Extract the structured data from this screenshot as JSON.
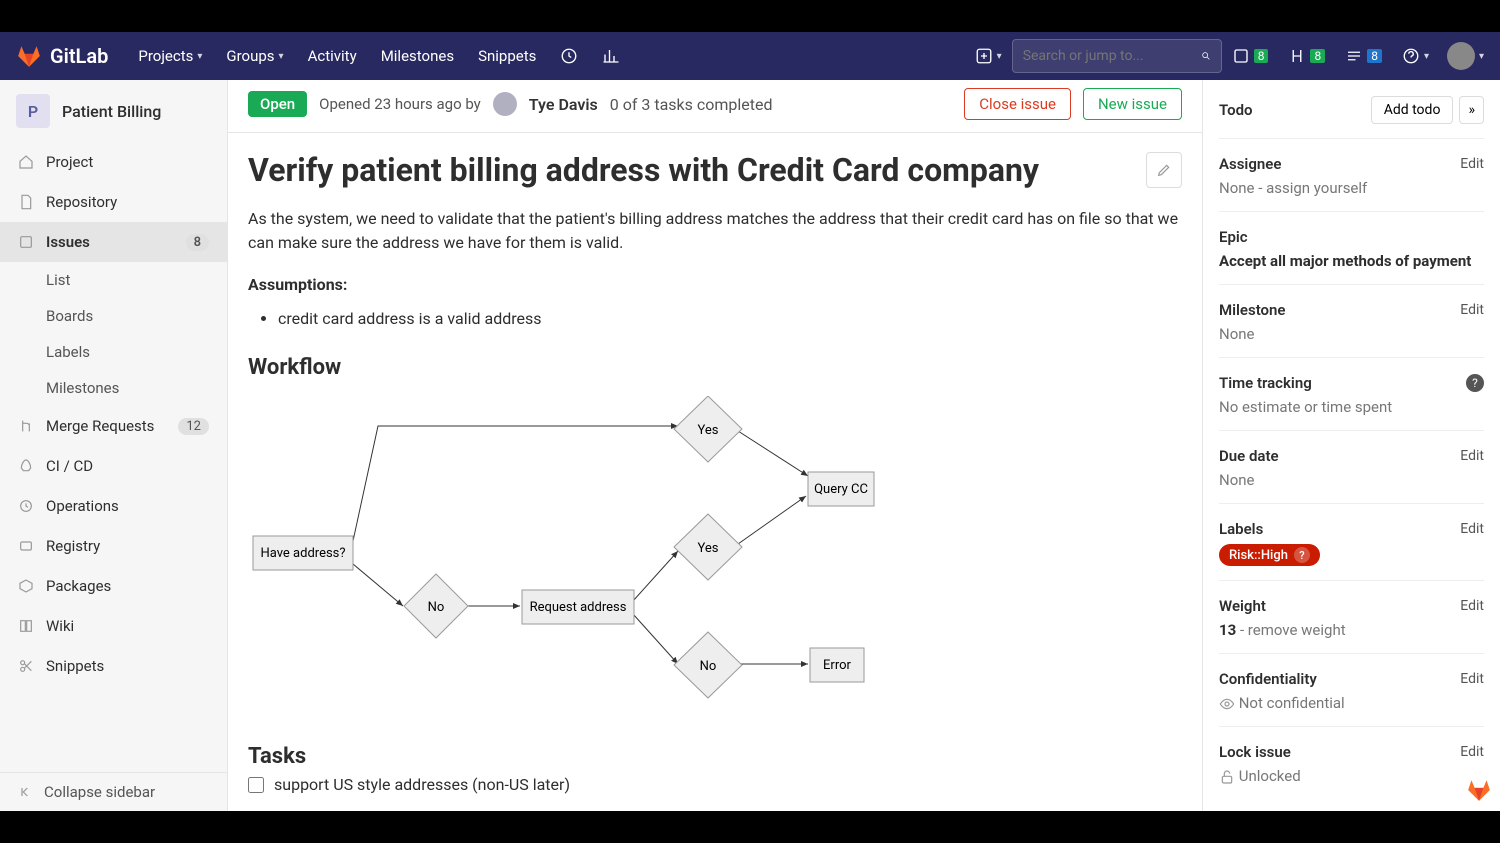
{
  "topnav": {
    "brand": "GitLab",
    "items": [
      "Projects",
      "Groups",
      "Activity",
      "Milestones",
      "Snippets"
    ],
    "search_placeholder": "Search or jump to...",
    "issues_count": "8",
    "mr_count": "8",
    "todos_count": "8"
  },
  "sidebar": {
    "project_initial": "P",
    "project_name": "Patient Billing",
    "items": [
      {
        "label": "Project"
      },
      {
        "label": "Repository"
      },
      {
        "label": "Issues",
        "count": "8",
        "active": true
      },
      {
        "label": "Merge Requests",
        "count": "12"
      },
      {
        "label": "CI / CD"
      },
      {
        "label": "Operations"
      },
      {
        "label": "Registry"
      },
      {
        "label": "Packages"
      },
      {
        "label": "Wiki"
      },
      {
        "label": "Snippets"
      }
    ],
    "subitems": [
      "List",
      "Boards",
      "Labels",
      "Milestones"
    ],
    "collapse": "Collapse sidebar"
  },
  "issue": {
    "status": "Open",
    "opened": "Opened 23 hours ago by",
    "author": "Tye Davis",
    "task_progress": "0 of 3 tasks completed",
    "close_btn": "Close issue",
    "new_btn": "New issue",
    "title": "Verify patient billing address with Credit Card company",
    "description": "As the system, we need to validate that the patient's billing address matches the address that their credit card has on file so that we can make sure the address we have for them is valid.",
    "assumptions_h": "Assumptions:",
    "assumptions": [
      "credit card address is a valid address"
    ],
    "workflow_h": "Workflow",
    "tasks_h": "Tasks",
    "tasks": [
      "support US style addresses (non-US later)"
    ]
  },
  "workflow": {
    "have_address": "Have address?",
    "yes1": "Yes",
    "yes2": "Yes",
    "no1": "No",
    "no2": "No",
    "request": "Request address",
    "query": "Query CC",
    "error": "Error"
  },
  "right": {
    "todo_label": "Todo",
    "add_todo": "Add todo",
    "assignee_h": "Assignee",
    "assignee_val": "None - assign yourself",
    "epic_h": "Epic",
    "epic_val": "Accept all major methods of payment",
    "milestone_h": "Milestone",
    "milestone_val": "None",
    "time_h": "Time tracking",
    "time_val": "No estimate or time spent",
    "due_h": "Due date",
    "due_val": "None",
    "labels_h": "Labels",
    "label_pill": "Risk::High",
    "weight_h": "Weight",
    "weight_val": "13",
    "weight_remove": " - remove weight",
    "conf_h": "Confidentiality",
    "conf_val": "Not confidential",
    "lock_h": "Lock issue",
    "lock_val": "Unlocked",
    "edit": "Edit"
  }
}
